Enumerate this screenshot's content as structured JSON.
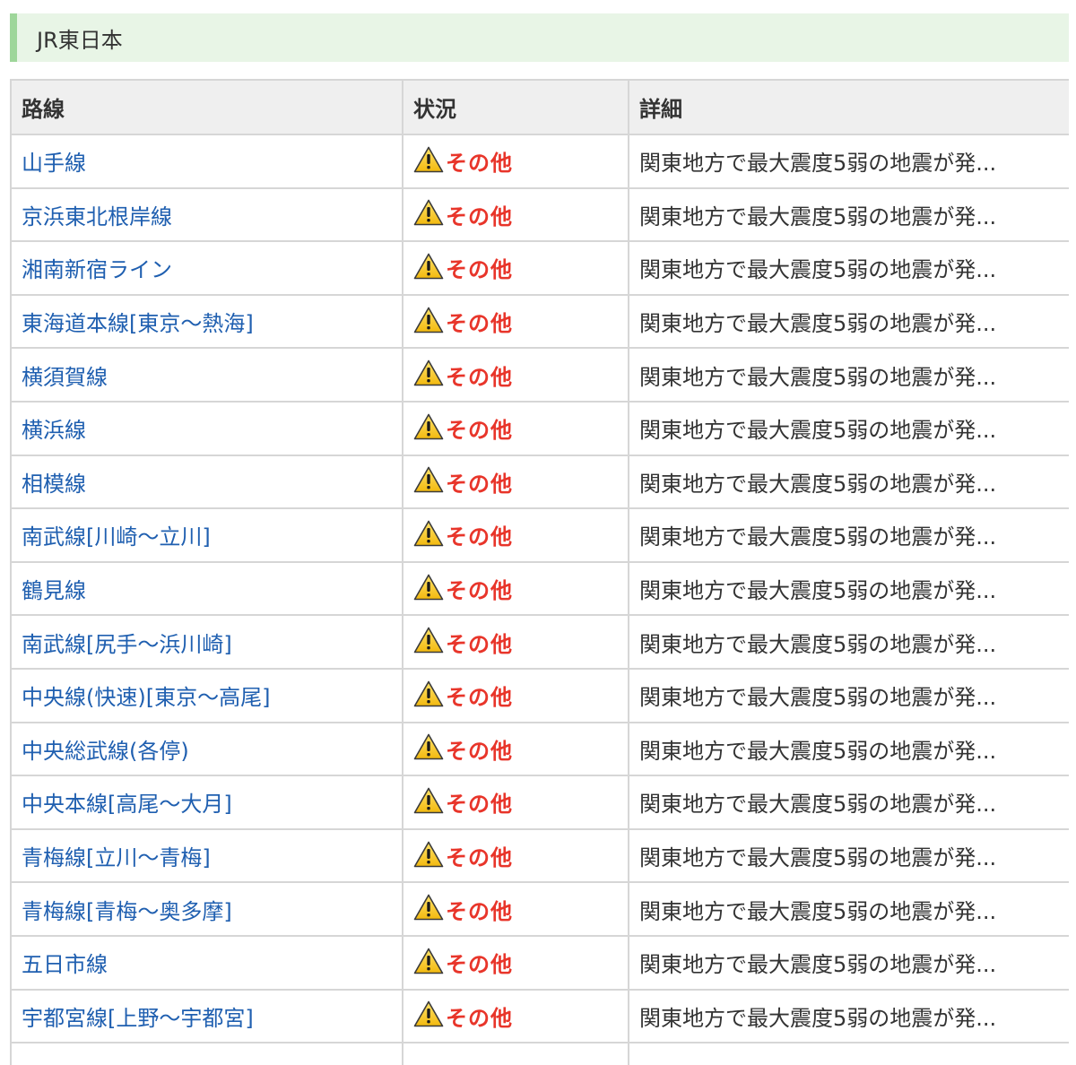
{
  "section": {
    "title": "JR東日本"
  },
  "table": {
    "headers": {
      "line": "路線",
      "status": "状況",
      "detail": "詳細"
    },
    "rows": [
      {
        "line": "山手線",
        "status": "その他",
        "detail": "関東地方で最大震度5弱の地震が発..."
      },
      {
        "line": "京浜東北根岸線",
        "status": "その他",
        "detail": "関東地方で最大震度5弱の地震が発..."
      },
      {
        "line": "湘南新宿ライン",
        "status": "その他",
        "detail": "関東地方で最大震度5弱の地震が発..."
      },
      {
        "line": "東海道本線[東京〜熱海]",
        "status": "その他",
        "detail": "関東地方で最大震度5弱の地震が発..."
      },
      {
        "line": "横須賀線",
        "status": "その他",
        "detail": "関東地方で最大震度5弱の地震が発..."
      },
      {
        "line": "横浜線",
        "status": "その他",
        "detail": "関東地方で最大震度5弱の地震が発..."
      },
      {
        "line": "相模線",
        "status": "その他",
        "detail": "関東地方で最大震度5弱の地震が発..."
      },
      {
        "line": "南武線[川崎〜立川]",
        "status": "その他",
        "detail": "関東地方で最大震度5弱の地震が発..."
      },
      {
        "line": "鶴見線",
        "status": "その他",
        "detail": "関東地方で最大震度5弱の地震が発..."
      },
      {
        "line": "南武線[尻手〜浜川崎]",
        "status": "その他",
        "detail": "関東地方で最大震度5弱の地震が発..."
      },
      {
        "line": "中央線(快速)[東京〜高尾]",
        "status": "その他",
        "detail": "関東地方で最大震度5弱の地震が発..."
      },
      {
        "line": "中央総武線(各停)",
        "status": "その他",
        "detail": "関東地方で最大震度5弱の地震が発..."
      },
      {
        "line": "中央本線[高尾〜大月]",
        "status": "その他",
        "detail": "関東地方で最大震度5弱の地震が発..."
      },
      {
        "line": "青梅線[立川〜青梅]",
        "status": "その他",
        "detail": "関東地方で最大震度5弱の地震が発..."
      },
      {
        "line": "青梅線[青梅〜奥多摩]",
        "status": "その他",
        "detail": "関東地方で最大震度5弱の地震が発..."
      },
      {
        "line": "五日市線",
        "status": "その他",
        "detail": "関東地方で最大震度5弱の地震が発..."
      },
      {
        "line": "宇都宮線[上野〜宇都宮]",
        "status": "その他",
        "detail": "関東地方で最大震度5弱の地震が発..."
      },
      {
        "line": "",
        "status": "",
        "detail": ""
      }
    ]
  },
  "icons": {
    "status_icon": "warning-icon"
  },
  "colors": {
    "link": "#1f5fb0",
    "status_text": "#e8352a",
    "warning_fill": "#f5c518",
    "header_bg": "#e8f5e6",
    "header_accent": "#9ed69a"
  }
}
